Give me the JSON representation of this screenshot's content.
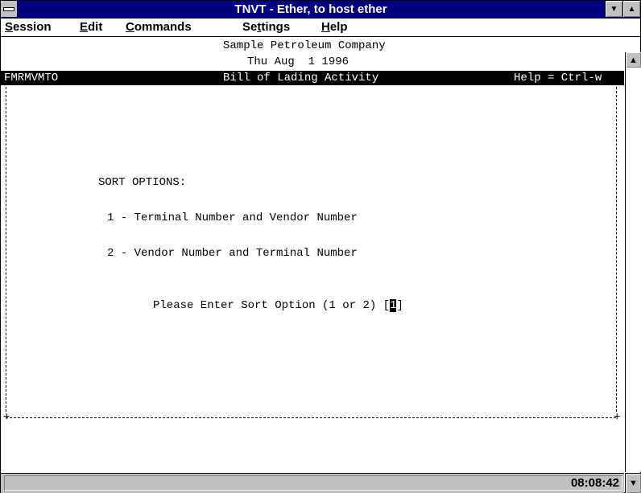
{
  "window": {
    "title": "TNVT - Ether, to host ether",
    "minimize_glyph": "▼",
    "maximize_glyph": "▲"
  },
  "menu": [
    {
      "label": "Session",
      "accel": "S",
      "rest": "ession"
    },
    {
      "label": "Edit",
      "accel": "E",
      "rest": "dit"
    },
    {
      "label": "Commands",
      "accel": "C",
      "rest": "ommands"
    },
    {
      "label": "Settings",
      "pre": "Se",
      "accel": "t",
      "rest": "tings"
    },
    {
      "label": "Help",
      "accel": "H",
      "rest": "elp"
    }
  ],
  "screen": {
    "company": "Sample Petroleum Company",
    "date": "Thu Aug  1 1996",
    "program_id": "FMRMVMTO",
    "screen_title": "Bill of Lading Activity",
    "help_hint": "Help = Ctrl-w",
    "sort_heading": "SORT OPTIONS:",
    "option_1": "1 - Terminal Number and Vendor Number",
    "option_2": "2 - Vendor Number and Terminal Number",
    "prompt": "Please Enter Sort Option (1 or 2) [",
    "prompt_end": "]",
    "input_value": "1"
  },
  "status": {
    "clock": "08:08:42"
  },
  "scrollbar": {
    "up_glyph": "▲",
    "down_glyph": "▼"
  }
}
